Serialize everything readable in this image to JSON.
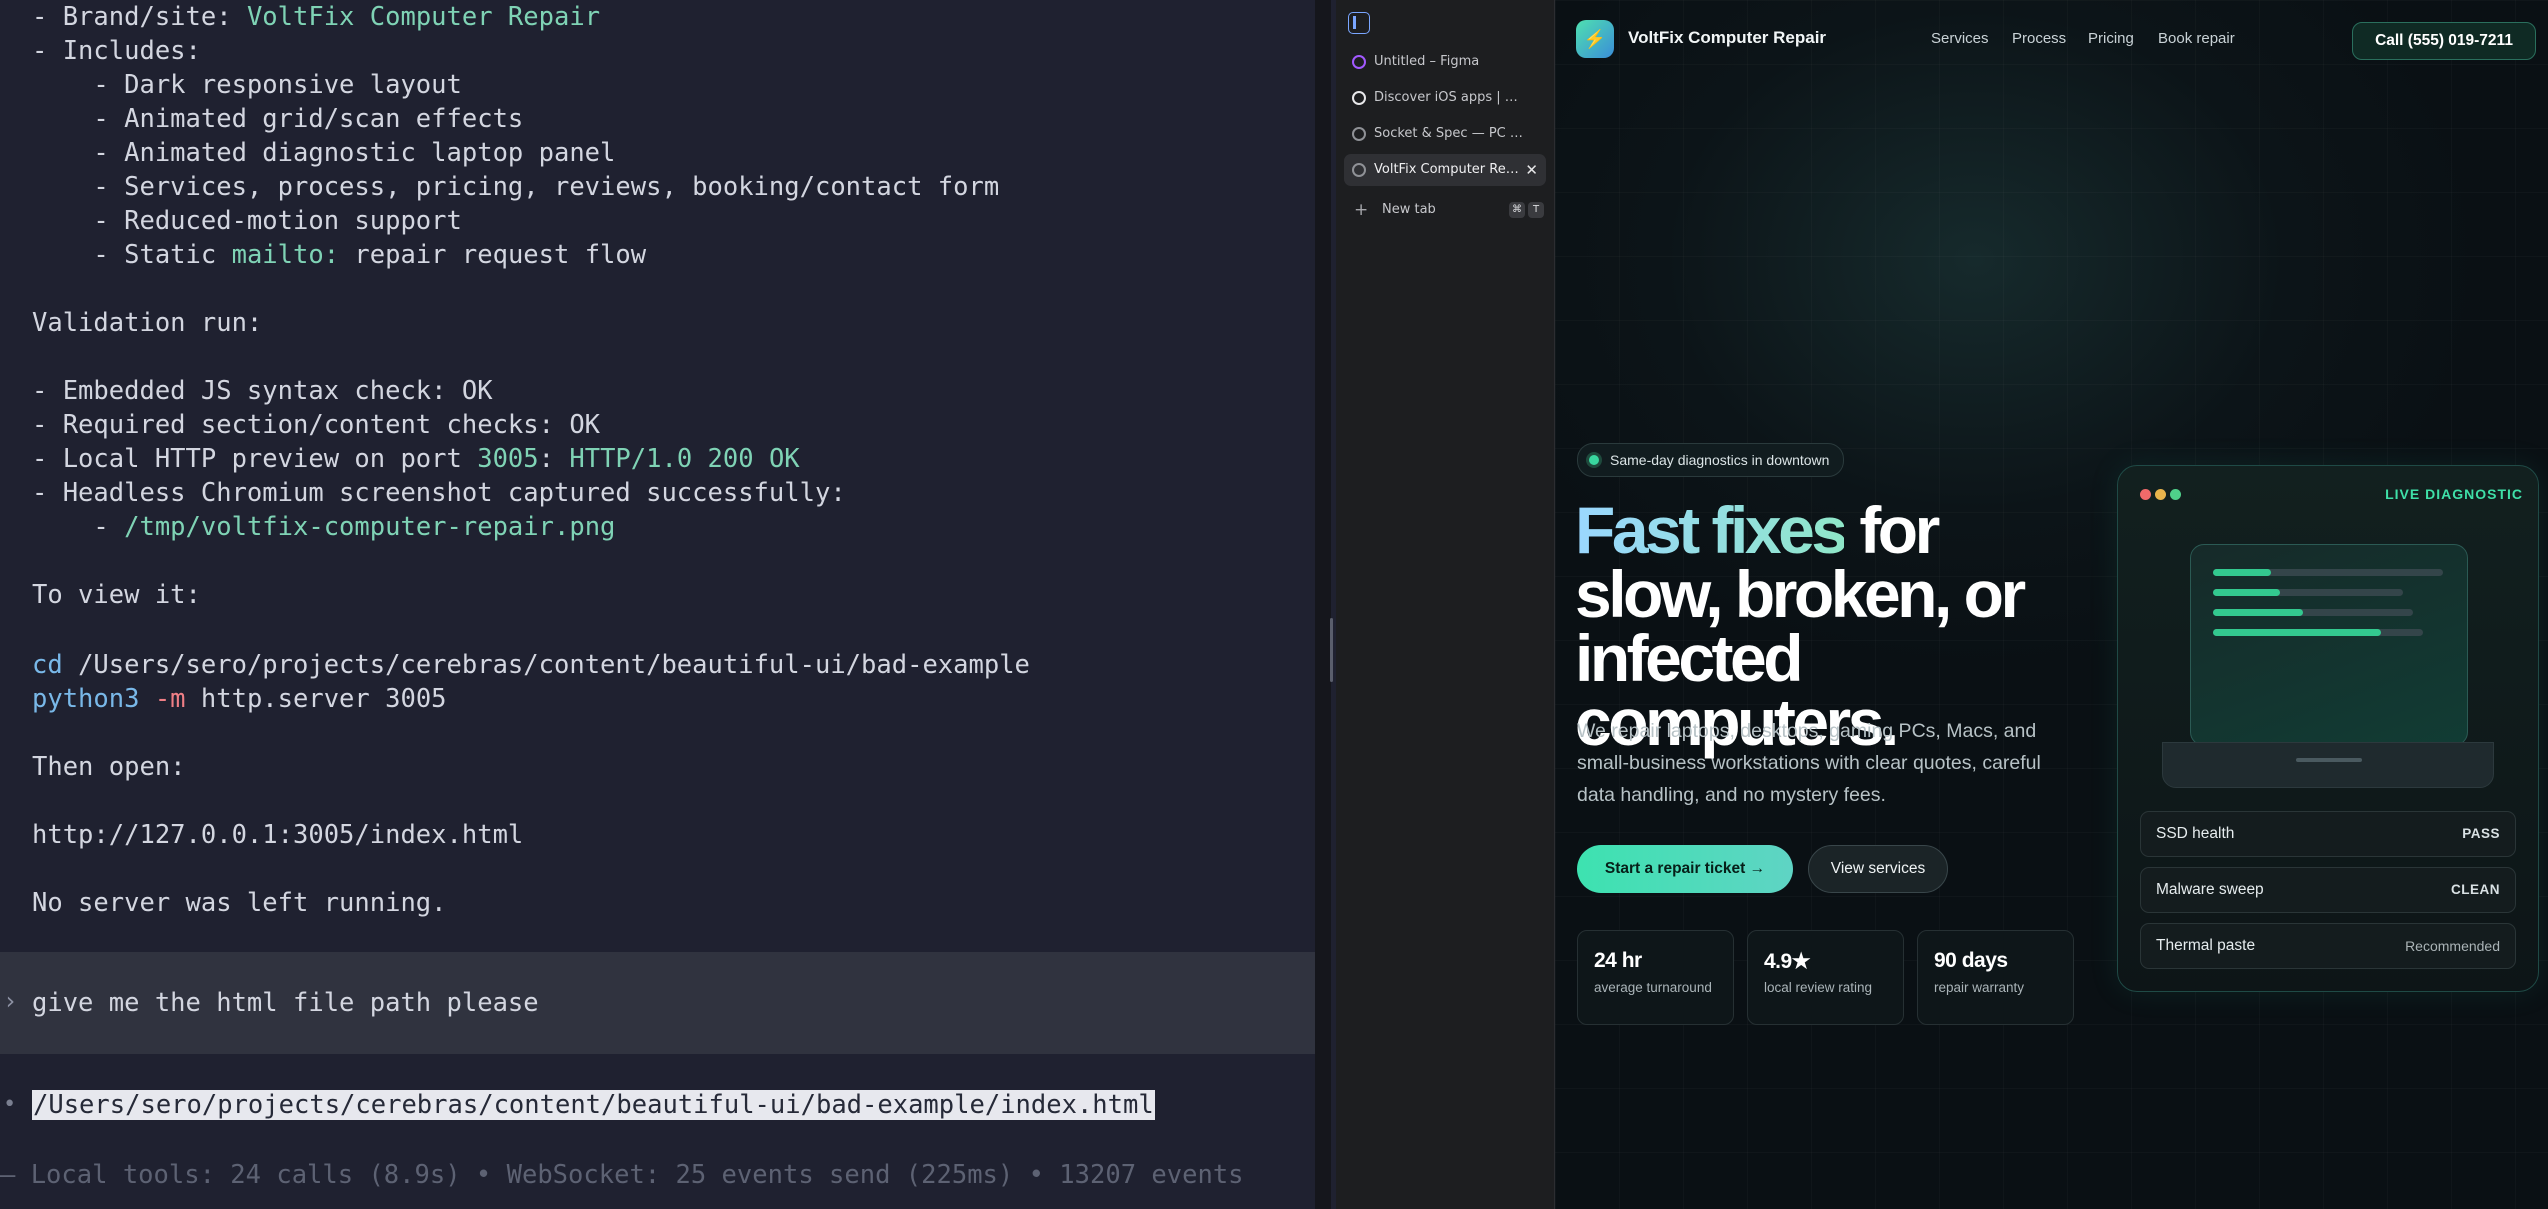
{
  "terminal": {
    "lines": [
      {
        "pre": "- Brand/site: ",
        "hl": "VoltFix Computer Repair",
        "post": ""
      },
      {
        "pre": "- Includes:",
        "hl": "",
        "post": ""
      },
      {
        "pre": "    - Dark responsive layout",
        "hl": "",
        "post": ""
      },
      {
        "pre": "    - Animated grid/scan effects",
        "hl": "",
        "post": ""
      },
      {
        "pre": "    - Animated diagnostic laptop panel",
        "hl": "",
        "post": ""
      },
      {
        "pre": "    - Services, process, pricing, reviews, booking/contact form",
        "hl": "",
        "post": ""
      },
      {
        "pre": "    - Reduced-motion support",
        "hl": "",
        "post": ""
      },
      {
        "pre": "    - Static ",
        "hl": "mailto:",
        "post": " repair request flow"
      },
      {
        "pre": "",
        "hl": "",
        "post": ""
      },
      {
        "pre": "Validation run:",
        "hl": "",
        "post": ""
      },
      {
        "pre": "",
        "hl": "",
        "post": ""
      },
      {
        "pre": "- Embedded JS syntax check: OK",
        "hl": "",
        "post": ""
      },
      {
        "pre": "- Required section/content checks: OK",
        "hl": "",
        "post": ""
      },
      {
        "pre": "- Local HTTP preview on port ",
        "hl": "3005",
        "post": ": ",
        "hl2": "HTTP/1.0 200 OK"
      },
      {
        "pre": "- Headless Chromium screenshot captured successfully:",
        "hl": "",
        "post": ""
      },
      {
        "pre": "    - ",
        "hl": "/tmp/voltfix-computer-repair.png",
        "post": ""
      },
      {
        "pre": "",
        "hl": "",
        "post": ""
      },
      {
        "pre": "To view it:",
        "hl": "",
        "post": ""
      },
      {
        "pre": "",
        "hl": "",
        "post": ""
      }
    ],
    "cd_cmd": "cd",
    "cd_path": " /Users/sero/projects/cerebras/content/beautiful-ui/bad-example",
    "py_cmd": "python3",
    "py_flag": " -m",
    "py_rest": " http.server 3005",
    "then_open": "Then open:",
    "url": "http://127.0.0.1:3005/index.html",
    "no_server": "No server was left running.",
    "prompt_mark": "›",
    "prompt_text": "give me the html file path please",
    "bullet_mark": "•",
    "answer_path": "/Users/sero/projects/cerebras/content/beautiful-ui/bad-example/index.html",
    "status": "— Local tools: 24 calls (8.9s) • WebSocket: 25 events send (225ms) • 13207 events",
    "colors": {
      "green": "#7fd3b5",
      "blue": "#79b8e8",
      "red": "#ef7f86"
    }
  },
  "browser": {
    "sidebar_icon": "sidebar-toggle-icon",
    "tabs": [
      {
        "label": "Untitled – Figma",
        "icon": "figma-icon",
        "active": false
      },
      {
        "label": "Discover iOS apps | Mobbin",
        "icon": "mobbin-icon",
        "active": false
      },
      {
        "label": "Socket & Spec — PC Parts Repair",
        "icon": "globe-icon",
        "active": false
      },
      {
        "label": "VoltFix Computer Repair",
        "icon": "globe-icon",
        "active": true
      }
    ],
    "close_glyph": "✕",
    "new_tab": {
      "label": "New tab",
      "keys": [
        "⌘",
        "T"
      ]
    }
  },
  "site": {
    "logo_glyph": "⚡",
    "brand": "VoltFix Computer Repair",
    "nav": [
      "Services",
      "Process",
      "Pricing",
      "Book repair"
    ],
    "call": "Call (555) 019-7211",
    "badge": "Same-day diagnostics in downtown",
    "headline_accent": "Fast fixes",
    "headline_rest": " for slow, broken, or infected computers.",
    "lead": "We repair laptops, desktops, gaming PCs, Macs, and small-business workstations with clear quotes, careful data handling, and no mystery fees.",
    "cta_primary": "Start a repair ticket →",
    "cta_secondary": "View services",
    "stats": [
      {
        "value": "24 hr",
        "label": "average turnaround"
      },
      {
        "value": "4.9★",
        "label": "local review rating"
      },
      {
        "value": "90 days",
        "label": "repair warranty"
      }
    ],
    "diagnostic": {
      "title": "LIVE DIAGNOSTIC",
      "progress": [
        0.25,
        0.35,
        0.45,
        0.8
      ],
      "checks": [
        {
          "name": "SSD health",
          "status": "PASS",
          "style": "bold"
        },
        {
          "name": "Malware sweep",
          "status": "CLEAN",
          "style": "bold"
        },
        {
          "name": "Thermal paste",
          "status": "Recommended",
          "style": "muted"
        }
      ]
    },
    "colors": {
      "accent": "#3de2b0",
      "bg": "#0c1418"
    }
  }
}
